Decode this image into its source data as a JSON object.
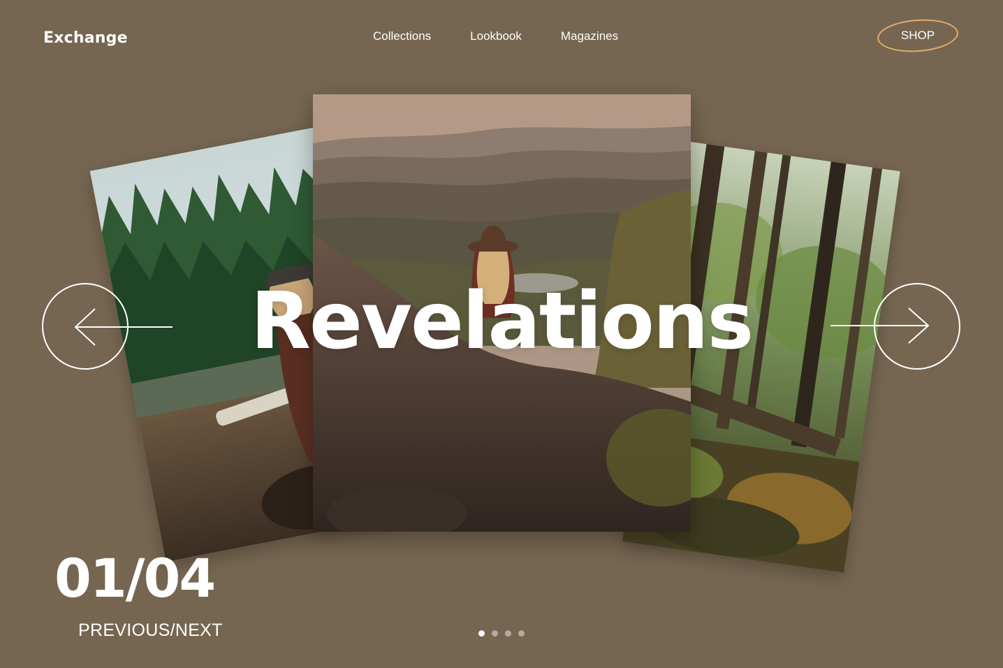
{
  "brand": {
    "name": "Exchange"
  },
  "nav": {
    "items": [
      {
        "label": "Collections"
      },
      {
        "label": "Lookbook"
      },
      {
        "label": "Magazines"
      }
    ]
  },
  "shop": {
    "label": "SHOP"
  },
  "slider": {
    "headline": "Revelations",
    "counter": "01/04",
    "prev_next_label": "PREVIOUS/NEXT",
    "total_slides": 4,
    "active_index": 0
  },
  "colors": {
    "background": "#766651",
    "shop_ring": "#e3ad6b",
    "text": "#ffffff"
  },
  "icons": {
    "prev": "arrow-left-icon",
    "next": "arrow-right-icon"
  }
}
